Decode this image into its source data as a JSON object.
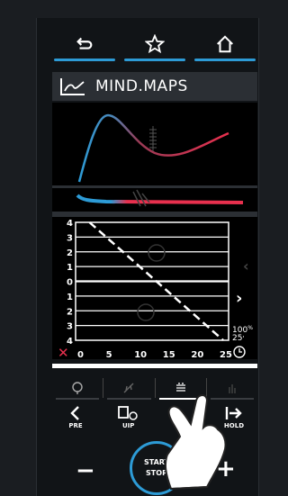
{
  "nav": {
    "back_icon": "return-arrow-icon",
    "favorite_icon": "star-icon",
    "home_icon": "home-icon"
  },
  "title": {
    "text": "MIND.MAPS",
    "icon": "line-chart-icon"
  },
  "chart_data": {
    "type": "line",
    "x": [
      0,
      5,
      10,
      15,
      20,
      25
    ],
    "y_ticks": [
      "4",
      "3",
      "2",
      "1",
      "0",
      "1",
      "2",
      "3",
      "4"
    ],
    "x_tick_labels": [
      "0",
      "5",
      "10",
      "15",
      "20",
      "25"
    ],
    "series": [
      {
        "x": [
          1.5,
          25
        ],
        "y": [
          4,
          -4
        ]
      }
    ],
    "right_labels": {
      "percent": "100",
      "percent_unit": "%",
      "time": "25",
      "time_unit": "'"
    },
    "close_symbol": "✕"
  },
  "colors": {
    "accent": "#2d9bd6",
    "curve_red": "#e8304e",
    "curve_blue": "#2d9bd6"
  },
  "actions": {
    "pre": "PRE",
    "uip": "UIP",
    "hold": "HOLD"
  },
  "start_stop": {
    "line1": "START",
    "line2": "STOP"
  },
  "controls": {
    "minus": "−",
    "plus": "+"
  }
}
